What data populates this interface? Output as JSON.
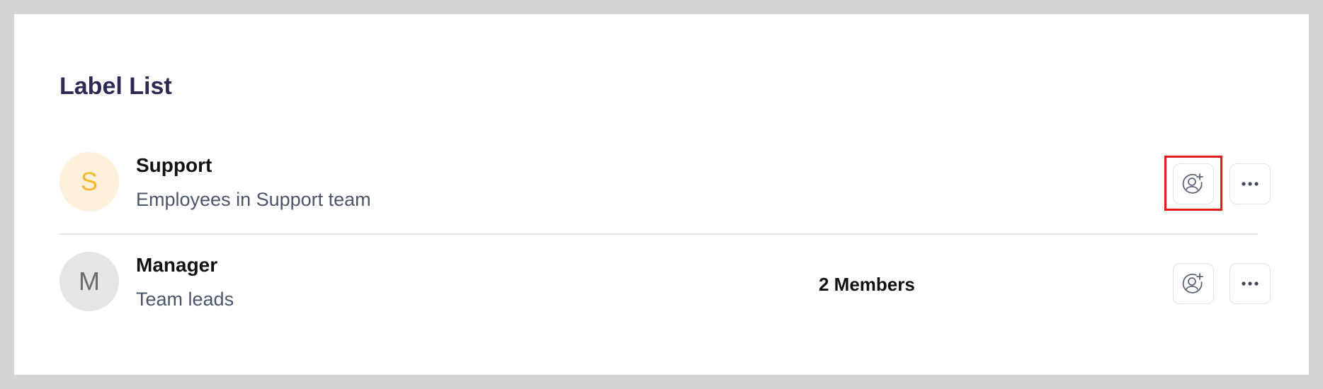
{
  "page": {
    "title": "Label List"
  },
  "labels": [
    {
      "initial": "S",
      "name": "Support",
      "description": "Employees in Support team",
      "members": ""
    },
    {
      "initial": "M",
      "name": "Manager",
      "description": "Team leads",
      "members": "2 Members"
    }
  ],
  "icons": {
    "add_member": "add-user-icon",
    "more": "more-horizontal-icon"
  },
  "colors": {
    "title": "#2a2a52",
    "support_avatar_bg": "#fdf1dc",
    "support_avatar_text": "#f5b92e",
    "manager_avatar_bg": "#e5e5e5",
    "manager_avatar_text": "#6b6b6b",
    "highlight": "#e31b1b"
  }
}
